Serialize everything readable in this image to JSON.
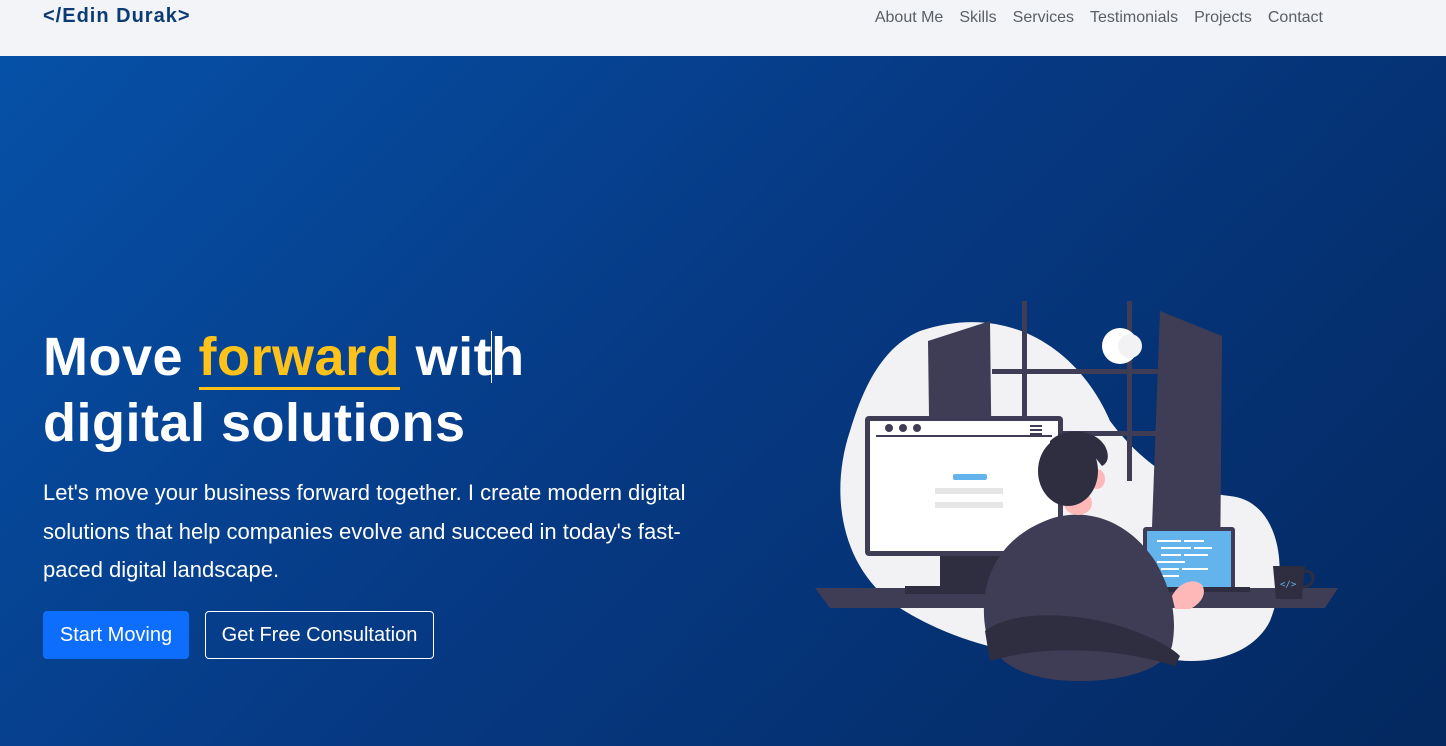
{
  "navbar": {
    "brand": "</Edin Durak>",
    "links": [
      "About Me",
      "Skills",
      "Services",
      "Testimonials",
      "Projects",
      "Contact"
    ]
  },
  "hero": {
    "headline_before": "Move ",
    "headline_highlight": "forward",
    "headline_after_1": " wit",
    "headline_after_2": "h",
    "headline_line2": "digital solutions",
    "subtitle": "Let's move your business forward together. I create modern digital solutions that help companies evolve and succeed in today's fast-paced digital landscape.",
    "primary_button": "Start Moving",
    "secondary_button": "Get Free Consultation"
  },
  "illustration": {
    "icon": "developer-at-desk-illustration",
    "mug_text": "</>"
  },
  "colors": {
    "navbar_bg": "#f2f4f7",
    "brand": "#0d3b73",
    "hero_gradient_start": "#0651a8",
    "hero_gradient_end": "#04285f",
    "accent": "#ffc21a",
    "primary_button": "#0d6efd"
  }
}
